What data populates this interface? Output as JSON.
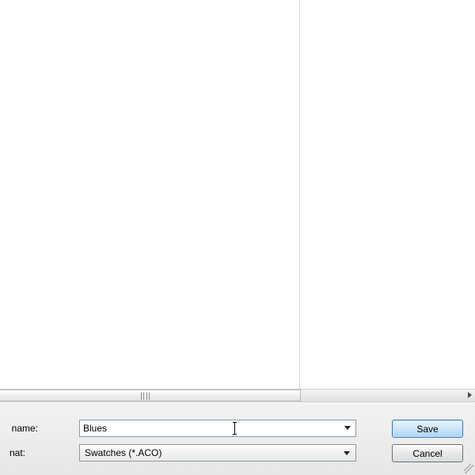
{
  "labels": {
    "filename": "name:",
    "format": "nat:"
  },
  "fields": {
    "filename_value": "Blues",
    "format_selected": "Swatches (*.ACO)"
  },
  "buttons": {
    "save": "Save",
    "cancel": "Cancel"
  }
}
